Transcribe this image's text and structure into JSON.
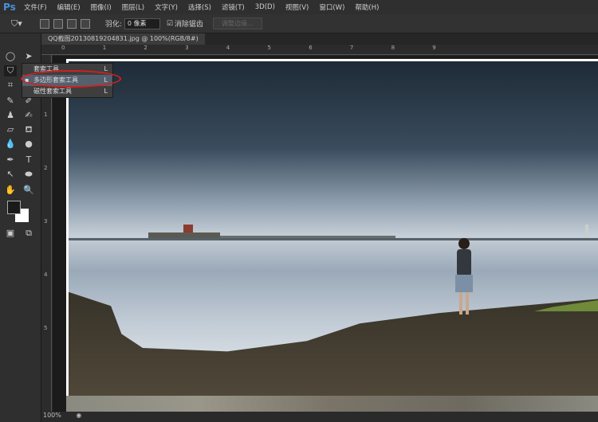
{
  "app": {
    "logo": "Ps"
  },
  "menu": [
    "文件(F)",
    "编辑(E)",
    "图像(I)",
    "图层(L)",
    "文字(Y)",
    "选择(S)",
    "滤镜(T)",
    "3D(D)",
    "视图(V)",
    "窗口(W)",
    "帮助(H)"
  ],
  "options": {
    "feather_label": "羽化:",
    "feather_value": "0 像素",
    "antialias_label": "消除锯齿",
    "antialias_checked": true,
    "refine_edge": "调整边缘..."
  },
  "document": {
    "tab_title": "QQ截图20130819204831.jpg @ 100%(RGB/8#)",
    "close": "×"
  },
  "ruler": {
    "h": [
      "0",
      "1",
      "2",
      "3",
      "4",
      "5",
      "6",
      "7",
      "8",
      "9"
    ],
    "v": [
      "1",
      "2",
      "3",
      "4",
      "5"
    ]
  },
  "flyout": [
    {
      "label": "套索工具",
      "key": "L"
    },
    {
      "label": "多边形套索工具",
      "key": "L",
      "selected": true
    },
    {
      "label": "磁性套索工具",
      "key": "L"
    }
  ],
  "status": {
    "zoom": "100%"
  },
  "colors": {
    "accent": "#4a90d9",
    "highlight": "#d42020",
    "foreground": "#1a1a1a",
    "background": "#ffffff"
  }
}
